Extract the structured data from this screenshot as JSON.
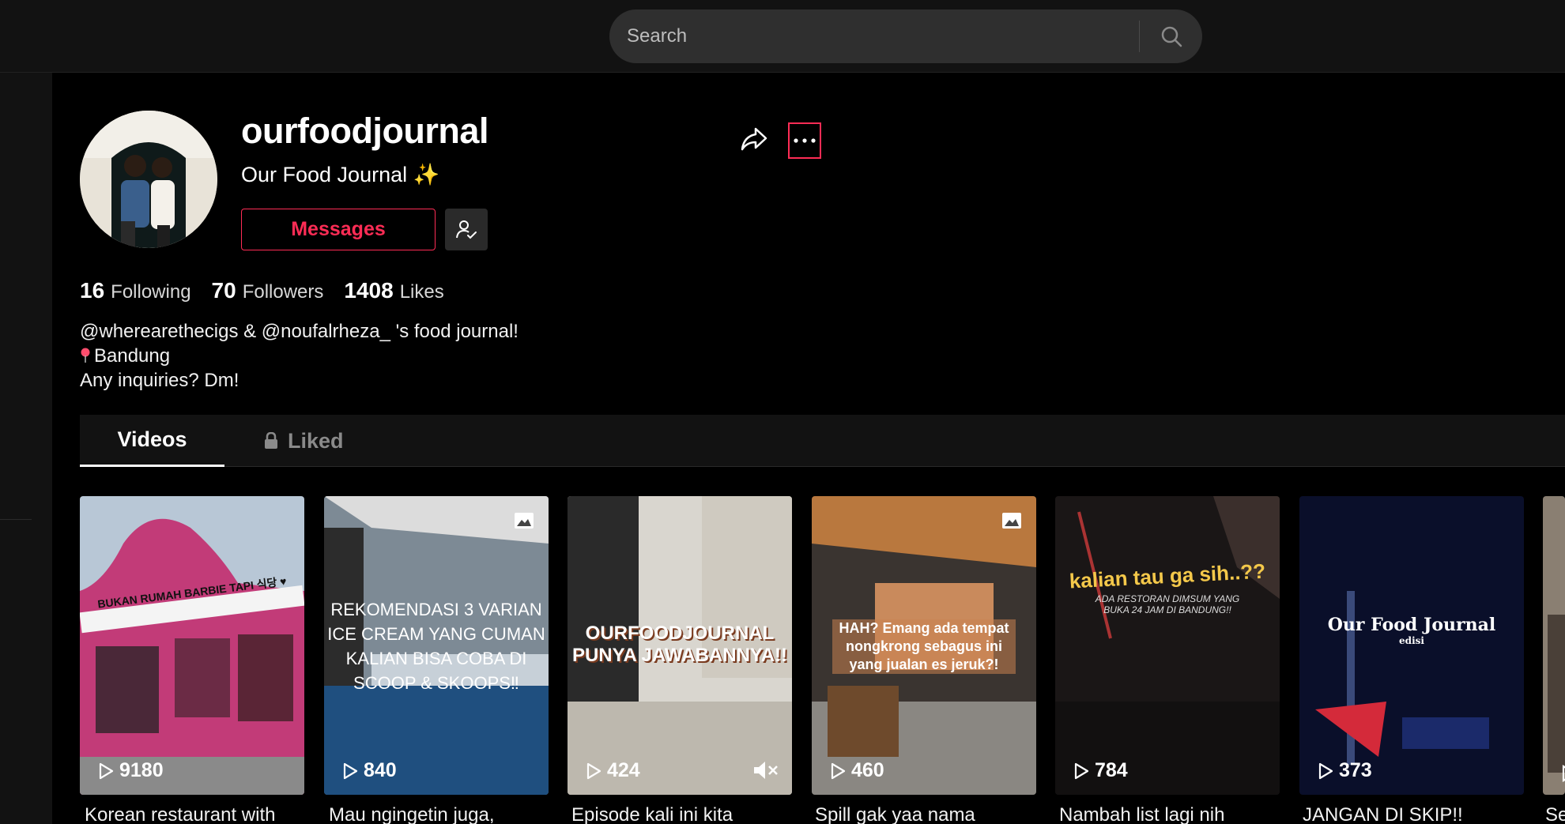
{
  "search": {
    "placeholder": "Search"
  },
  "profile": {
    "username": "ourfoodjournal",
    "nickname": "Our Food Journal ✨",
    "messages_label": "Messages",
    "stats": [
      {
        "value": "16",
        "label": "Following"
      },
      {
        "value": "70",
        "label": "Followers"
      },
      {
        "value": "1408",
        "label": "Likes"
      }
    ],
    "bio": {
      "line1": "@wherearethecigs & @noufalrheza_ 's food journal!",
      "line2": "Bandung",
      "line3": "Any inquiries? Dm!"
    }
  },
  "tabs": {
    "videos": "Videos",
    "liked": "Liked"
  },
  "videos": [
    {
      "views": "9180",
      "title": "Korean restaurant with",
      "overlay_sign": "BUKAN RUMAH BARBIE TAPI 식당 ♥"
    },
    {
      "views": "840",
      "title": "Mau ngingetin juga,",
      "overlay_text": [
        "REKOMENDASI 3 VARIAN",
        "ICE CREAM YANG CUMAN",
        "KALIAN BISA COBA DI",
        "SCOOP & SKOOPS‼"
      ]
    },
    {
      "views": "424",
      "title": "Episode kali ini kita",
      "overlay_text": [
        "OURFOODJOURNAL",
        "PUNYA JAWABANNYA!!"
      ]
    },
    {
      "views": "460",
      "title": "Spill gak yaa nama",
      "overlay_text": [
        "HAH? Emang ada tempat",
        "nongkrong sebagus ini",
        "yang jualan es jeruk?!"
      ]
    },
    {
      "views": "784",
      "title": "Nambah list lagi nih",
      "overlay_text": [
        "kalian tau ga sih..??",
        "ADA RESTORAN DIMSUM YANG",
        "BUKA 24 JAM DI BANDUNG!!"
      ]
    },
    {
      "views": "373",
      "title": "JANGAN DI SKIP!!",
      "overlay_text": [
        "Our Food Journal",
        "edisi"
      ]
    },
    {
      "views": "",
      "title": "Se"
    }
  ],
  "colors": {
    "accent": "#fe2c55",
    "background": "#000000",
    "surface": "#121212"
  }
}
